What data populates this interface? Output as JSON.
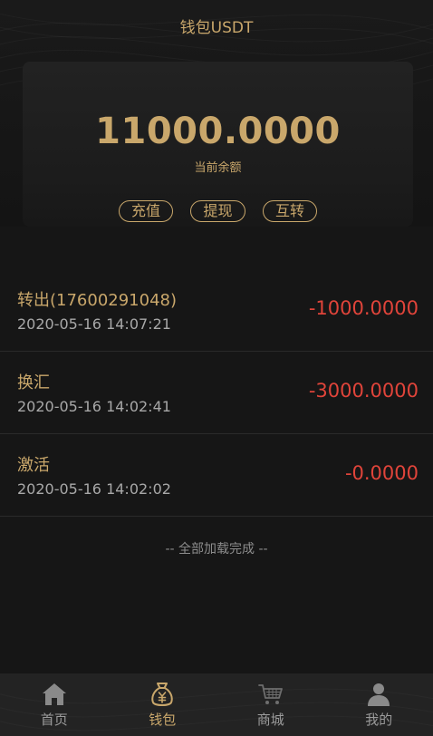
{
  "header": {
    "title": "钱包USDT"
  },
  "wallet": {
    "balance": "11000.0000",
    "balance_label": "当前余额",
    "actions": [
      {
        "label": "充值"
      },
      {
        "label": "提现"
      },
      {
        "label": "互转"
      }
    ]
  },
  "transactions": [
    {
      "title": "转出(17600291048)",
      "time": "2020-05-16 14:07:21",
      "amount": "-1000.0000"
    },
    {
      "title": "换汇",
      "time": "2020-05-16 14:02:41",
      "amount": "-3000.0000"
    },
    {
      "title": "激活",
      "time": "2020-05-16 14:02:02",
      "amount": "-0.0000"
    }
  ],
  "list_end_text": "-- 全部加载完成 --",
  "tabbar": {
    "active_index": 1,
    "items": [
      {
        "label": "首页",
        "icon": "home-icon"
      },
      {
        "label": "钱包",
        "icon": "money-bag-icon"
      },
      {
        "label": "商城",
        "icon": "cart-icon"
      },
      {
        "label": "我的",
        "icon": "user-icon"
      }
    ]
  },
  "colors": {
    "background": "#161616",
    "gold_accent": "#c9a76b",
    "negative_amount": "#e0443a",
    "tab_inactive": "#9b9b9b"
  }
}
